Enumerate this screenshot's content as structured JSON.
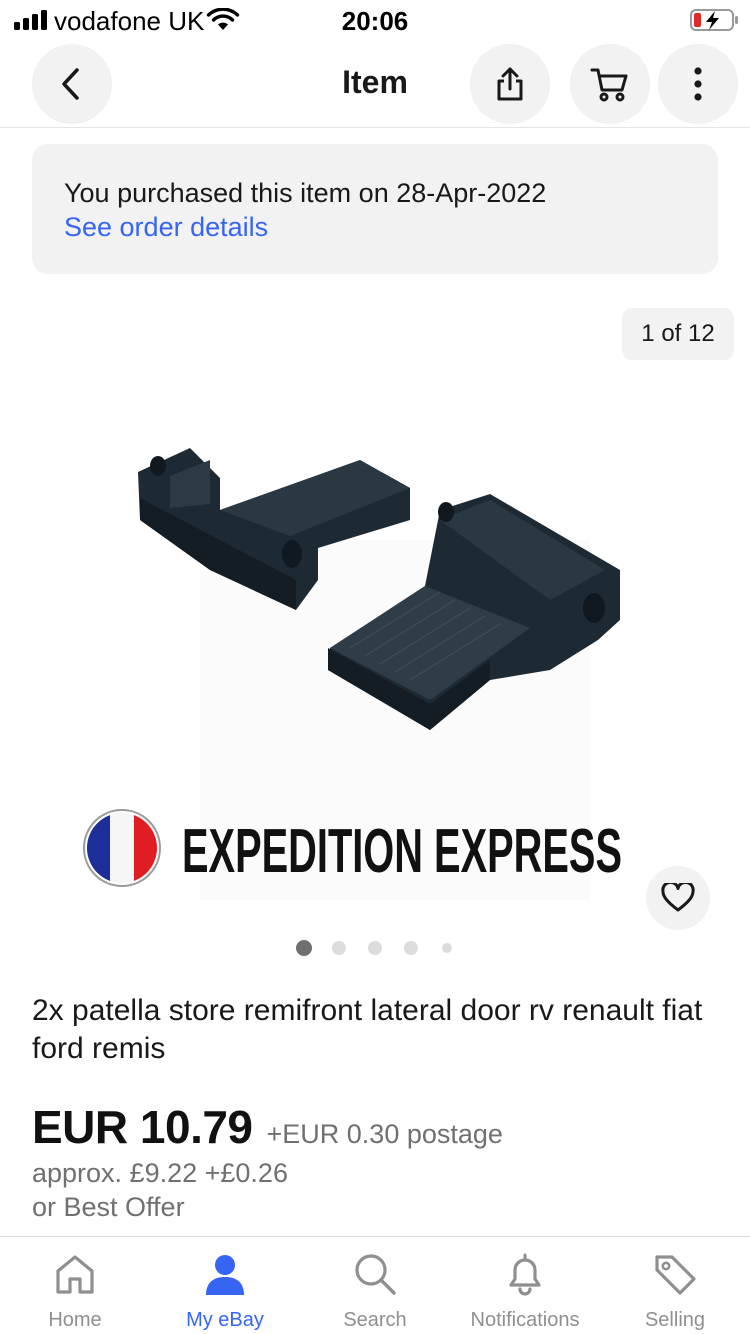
{
  "status_bar": {
    "carrier": "vodafone UK",
    "time": "20:06"
  },
  "nav": {
    "title": "Item",
    "icons": [
      "back-arrow-icon",
      "share-icon",
      "cart-icon",
      "more-vertical-icon"
    ]
  },
  "purchase_banner": {
    "text": "You purchased this item on 28-Apr-2022",
    "link": "See order details"
  },
  "gallery": {
    "counter": "1 of 12",
    "image_brand_text": "EXPEDITION EXPRESS",
    "current_index": 1,
    "visible_dots": 5,
    "watch_icon": "heart-icon"
  },
  "item": {
    "title": "2x patella store remifront lateral door rv renault fiat ford remis",
    "price": "EUR 10.79",
    "postage": "+EUR 0.30 postage",
    "approx": "approx. £9.22 +£0.26",
    "best_offer": "or Best Offer"
  },
  "tab_bar": {
    "tabs": [
      {
        "label": "Home",
        "icon": "home-icon"
      },
      {
        "label": "My eBay",
        "icon": "person-icon"
      },
      {
        "label": "Search",
        "icon": "search-icon"
      },
      {
        "label": "Notifications",
        "icon": "bell-icon"
      },
      {
        "label": "Selling",
        "icon": "tag-icon"
      }
    ],
    "active": "My eBay"
  },
  "colors": {
    "link": "#3665f3",
    "panel": "#f2f2f2",
    "text": "#191919",
    "muted": "#707070"
  }
}
